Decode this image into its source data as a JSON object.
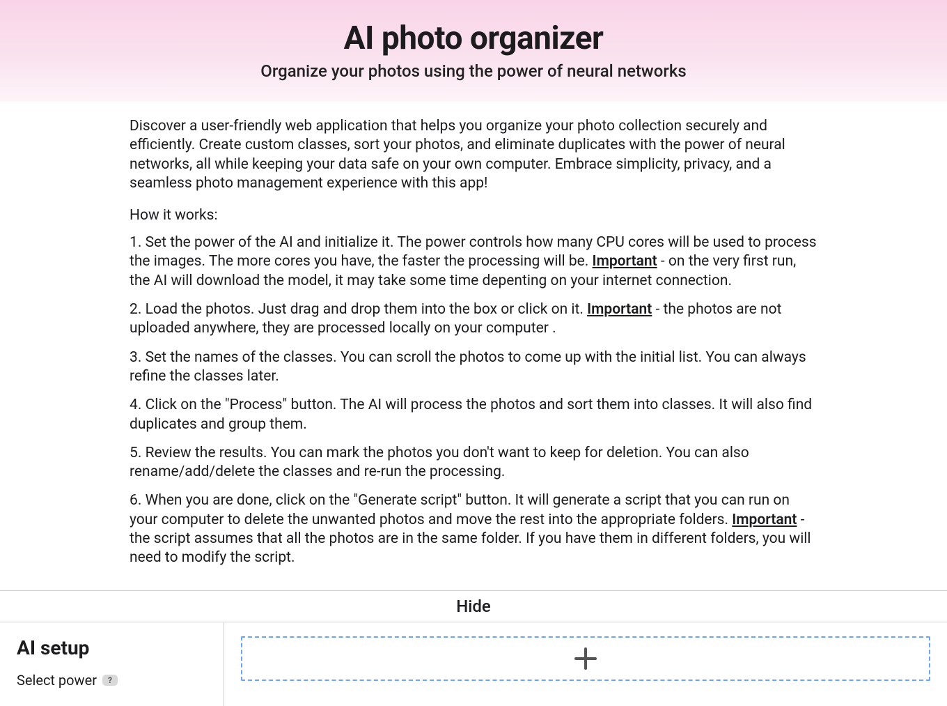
{
  "hero": {
    "title": "AI photo organizer",
    "subtitle": "Organize your photos using the power of neural networks"
  },
  "intro": "Discover a user-friendly web application that helps you organize your photo collection securely and efficiently. Create custom classes, sort your photos, and eliminate duplicates with the power of neural networks, all while keeping your data safe on your own computer. Embrace simplicity, privacy, and a seamless photo management experience with this app!",
  "how_label": "How it works:",
  "steps": [
    {
      "a": "Set the power of the AI and initialize it. The power controls how many CPU cores will be used to process the images. The more cores you have, the faster the processing will be. ",
      "imp": "Important",
      "b": " - on the very first run, the AI will download the model, it may take some time depenting on your internet connection."
    },
    {
      "a": "Load the photos. Just drag and drop them into the box or click on it. ",
      "imp": "Important",
      "b": " - the photos are not uploaded anywhere, they are processed locally on your computer ."
    },
    {
      "a": "Set the names of the classes. You can scroll the photos to come up with the initial list. You can always refine the classes later.",
      "imp": "",
      "b": ""
    },
    {
      "a": "Click on the \"Process\" button. The AI will process the photos and sort them into classes. It will also find duplicates and group them.",
      "imp": "",
      "b": ""
    },
    {
      "a": "Review the results. You can mark the photos you don't want to keep for deletion. You can also rename/add/delete the classes and re-run the processing.",
      "imp": "",
      "b": ""
    },
    {
      "a": "When you are done, click on the \"Generate script\" button. It will generate a script that you can run on your computer to delete the unwanted photos and move the rest into the appropriate folders. ",
      "imp": "Important",
      "b": " - the script assumes that all the photos are in the same folder. If you have them in different folders, you will need to modify the script."
    }
  ],
  "hide_label": "Hide",
  "sidebar": {
    "title": "AI setup",
    "select_power_label": "Select power",
    "help_glyph": "?"
  }
}
